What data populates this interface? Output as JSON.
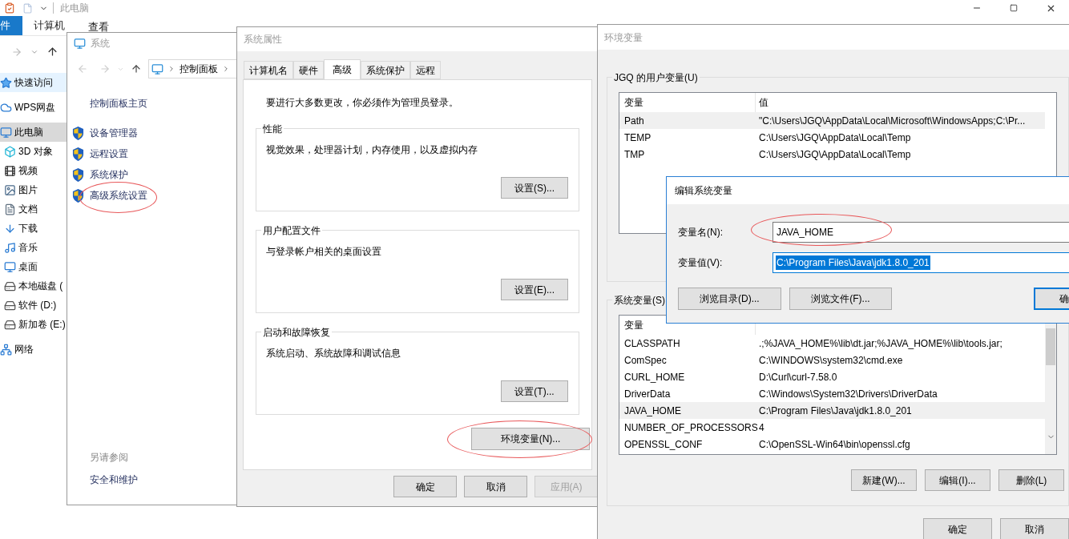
{
  "explorer": {
    "title": "此电脑",
    "ribbon_tabs": [
      {
        "label": "件",
        "selected": true
      },
      {
        "label": "计算机",
        "selected": false
      },
      {
        "label": "查看",
        "selected": false
      }
    ],
    "nav": [
      {
        "label": "快速访问",
        "kind": "star",
        "selected": false,
        "highlighted": true
      },
      {
        "label": "WPS网盘",
        "kind": "cloud",
        "selected": false,
        "highlighted": false
      },
      {
        "label": "此电脑",
        "kind": "pc",
        "selected": true,
        "highlighted": false,
        "children": [
          {
            "label": "3D 对象",
            "kind": "cube",
            "selected": false,
            "highlighted": false
          },
          {
            "label": "视频",
            "kind": "film",
            "selected": false,
            "highlighted": false
          },
          {
            "label": "图片",
            "kind": "image",
            "selected": false,
            "highlighted": false
          },
          {
            "label": "文档",
            "kind": "doc",
            "selected": false,
            "highlighted": false
          },
          {
            "label": "下载",
            "kind": "download",
            "selected": false,
            "highlighted": false
          },
          {
            "label": "音乐",
            "kind": "music",
            "selected": false,
            "highlighted": false
          },
          {
            "label": "桌面",
            "kind": "desktop",
            "selected": false,
            "highlighted": false
          },
          {
            "label": "本地磁盘 (",
            "kind": "drive",
            "selected": false,
            "highlighted": false
          },
          {
            "label": "软件 (D:)",
            "kind": "drive",
            "selected": false,
            "highlighted": false
          },
          {
            "label": "新加卷 (E:)",
            "kind": "drive",
            "selected": false,
            "highlighted": false
          }
        ]
      },
      {
        "label": "网络",
        "kind": "network",
        "selected": false,
        "highlighted": false
      }
    ]
  },
  "system": {
    "title": "系统",
    "breadcrumb": "控制面板",
    "home_link": "控制面板主页",
    "tasks": [
      {
        "label": "设备管理器"
      },
      {
        "label": "远程设置"
      },
      {
        "label": "系统保护"
      },
      {
        "label": "高级系统设置",
        "circled": true
      }
    ],
    "see_also_heading": "另请参阅",
    "see_also": [
      "安全和维护"
    ]
  },
  "system_properties": {
    "title": "系统属性",
    "tabs": [
      {
        "label": "计算机名",
        "selected": false
      },
      {
        "label": "硬件",
        "selected": false
      },
      {
        "label": "高级",
        "selected": true
      },
      {
        "label": "系统保护",
        "selected": false
      },
      {
        "label": "远程",
        "selected": false
      }
    ],
    "notice": "要进行大多数更改，你必须作为管理员登录。",
    "groups": [
      {
        "title": "性能",
        "description": "视觉效果，处理器计划，内存使用，以及虚拟内存",
        "button": "设置(S)..."
      },
      {
        "title": "用户配置文件",
        "description": "与登录帐户相关的桌面设置",
        "button": "设置(E)..."
      },
      {
        "title": "启动和故障恢复",
        "description": "系统启动、系统故障和调试信息",
        "button": "设置(T)..."
      }
    ],
    "env_button": {
      "label": "环境变量(N)...",
      "circled": true
    },
    "buttons": [
      {
        "label": "确定",
        "disabled": false
      },
      {
        "label": "取消",
        "disabled": false
      },
      {
        "label": "应用(A)",
        "disabled": true
      }
    ]
  },
  "environment_variables": {
    "title": "环境变量",
    "user_group": {
      "title": "JGQ 的用户变量(U)",
      "columns": [
        "变量",
        "值"
      ],
      "rows": [
        {
          "name": "Path",
          "value": "\"C:\\Users\\JGQ\\AppData\\Local\\Microsoft\\WindowsApps;C:\\Pr...",
          "selected": true
        },
        {
          "name": "TEMP",
          "value": "C:\\Users\\JGQ\\AppData\\Local\\Temp",
          "selected": false
        },
        {
          "name": "TMP",
          "value": "C:\\Users\\JGQ\\AppData\\Local\\Temp",
          "selected": false
        }
      ]
    },
    "system_group": {
      "title": "系统变量(S)",
      "columns": [
        "变量"
      ],
      "rows": [
        {
          "name": "CLASSPATH",
          "value": ".;%JAVA_HOME%\\lib\\dt.jar;%JAVA_HOME%\\lib\\tools.jar;",
          "selected": false
        },
        {
          "name": "ComSpec",
          "value": "C:\\WINDOWS\\system32\\cmd.exe",
          "selected": false
        },
        {
          "name": "CURL_HOME",
          "value": "D:\\Curl\\curl-7.58.0",
          "selected": false
        },
        {
          "name": "DriverData",
          "value": "C:\\Windows\\System32\\Drivers\\DriverData",
          "selected": false
        },
        {
          "name": "JAVA_HOME",
          "value": "C:\\Program Files\\Java\\jdk1.8.0_201",
          "selected": true
        },
        {
          "name": "NUMBER_OF_PROCESSORS",
          "value": "4",
          "selected": false
        },
        {
          "name": "OPENSSL_CONF",
          "value": "C:\\OpenSSL-Win64\\bin\\openssl.cfg",
          "selected": false
        }
      ],
      "buttons": [
        "新建(W)...",
        "编辑(I)...",
        "删除(L)"
      ]
    },
    "buttons": [
      "确定",
      "取消"
    ]
  },
  "edit_dialog": {
    "title": "编辑系统变量",
    "fields": [
      {
        "label": "变量名(N):",
        "value": "JAVA_HOME",
        "focused": false,
        "circled": true
      },
      {
        "label": "变量值(V):",
        "value": "C:\\Program Files\\Java\\jdk1.8.0_201",
        "focused": true
      }
    ],
    "buttons": [
      {
        "label": "浏览目录(D)...",
        "default": false
      },
      {
        "label": "浏览文件(F)...",
        "default": false
      },
      {
        "label": "确",
        "default": true
      }
    ]
  }
}
